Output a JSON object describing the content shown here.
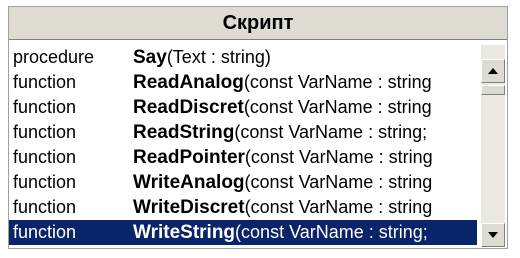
{
  "header": {
    "title": "Скрипт"
  },
  "rows": [
    {
      "kind": "procedure",
      "name": "Say",
      "params": "(Text : string)"
    },
    {
      "kind": "function",
      "name": "ReadAnalog",
      "params": "(const VarName : string"
    },
    {
      "kind": "function",
      "name": "ReadDiscret",
      "params": "(const VarName : string"
    },
    {
      "kind": "function",
      "name": "ReadString",
      "params": "(const VarName : string;"
    },
    {
      "kind": "function",
      "name": "ReadPointer",
      "params": "(const VarName : string"
    },
    {
      "kind": "function",
      "name": "WriteAnalog",
      "params": "(const VarName : string"
    },
    {
      "kind": "function",
      "name": "WriteDiscret",
      "params": "(const VarName : string"
    },
    {
      "kind": "function",
      "name": "WriteString",
      "params": "(const VarName : string;"
    }
  ],
  "selected_index": 7,
  "colors": {
    "header_bg": "#dedbd3",
    "selection_bg": "#0a246a"
  }
}
